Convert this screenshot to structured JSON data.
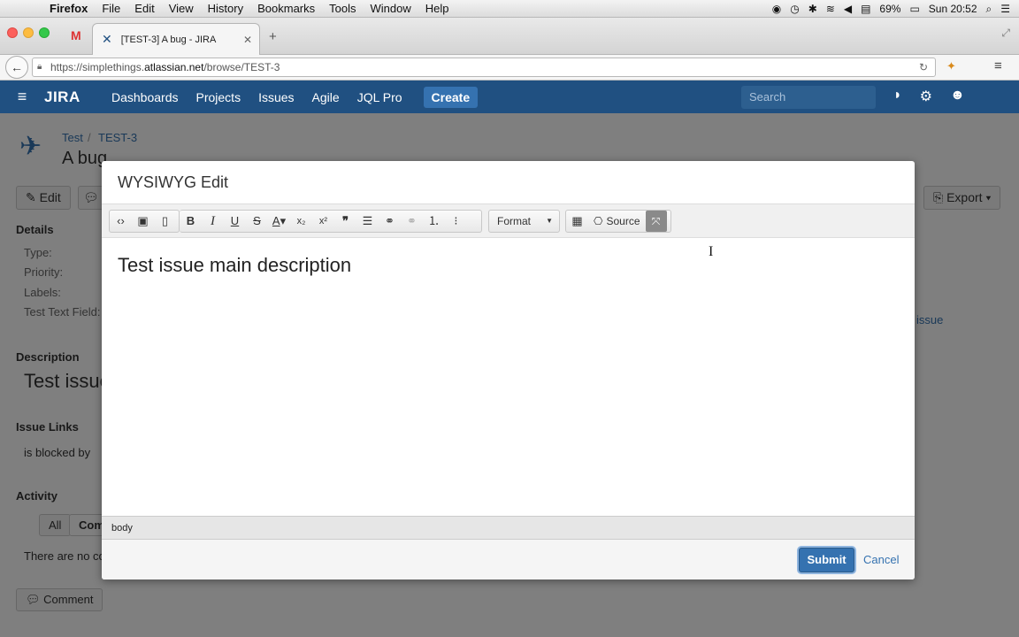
{
  "mac_menubar": {
    "app_name": "Firefox",
    "menus": [
      "File",
      "Edit",
      "View",
      "History",
      "Bookmarks",
      "Tools",
      "Window",
      "Help"
    ],
    "battery": "69%",
    "clock": "Sun 20:52"
  },
  "browser": {
    "tab_title": "[TEST-3] A bug - JIRA",
    "url_prefix": "https://simplethings.",
    "url_host": "atlassian.net",
    "url_path": "/browse/TEST-3"
  },
  "jira_header": {
    "logo": "JIRA",
    "nav": [
      "Dashboards",
      "Projects",
      "Issues",
      "Agile",
      "JQL Pro"
    ],
    "create_label": "Create",
    "search_placeholder": "Search"
  },
  "issue_page": {
    "breadcrumb_project": "Test",
    "breadcrumb_key": "TEST-3",
    "title": "A bug",
    "edit_label": "Edit",
    "export_label": "Export",
    "details_heading": "Details",
    "fields": [
      "Type:",
      "Priority:",
      "Labels:",
      "Test Text Field:"
    ],
    "description_heading": "Description",
    "description_preview": "Test issue",
    "issue_links_heading": "Issue Links",
    "issue_links_relation": "is blocked by",
    "right_issue_link": "issue",
    "activity_heading": "Activity",
    "activity_tabs": [
      "All",
      "Com"
    ],
    "activity_empty": "There are no co",
    "comment_label": "Comment"
  },
  "dialog": {
    "title": "WYSIWYG Edit",
    "format_label": "Format",
    "source_label": "Source",
    "editor_content": "Test issue main description",
    "status_path": "body",
    "submit_label": "Submit",
    "cancel_label": "Cancel"
  }
}
